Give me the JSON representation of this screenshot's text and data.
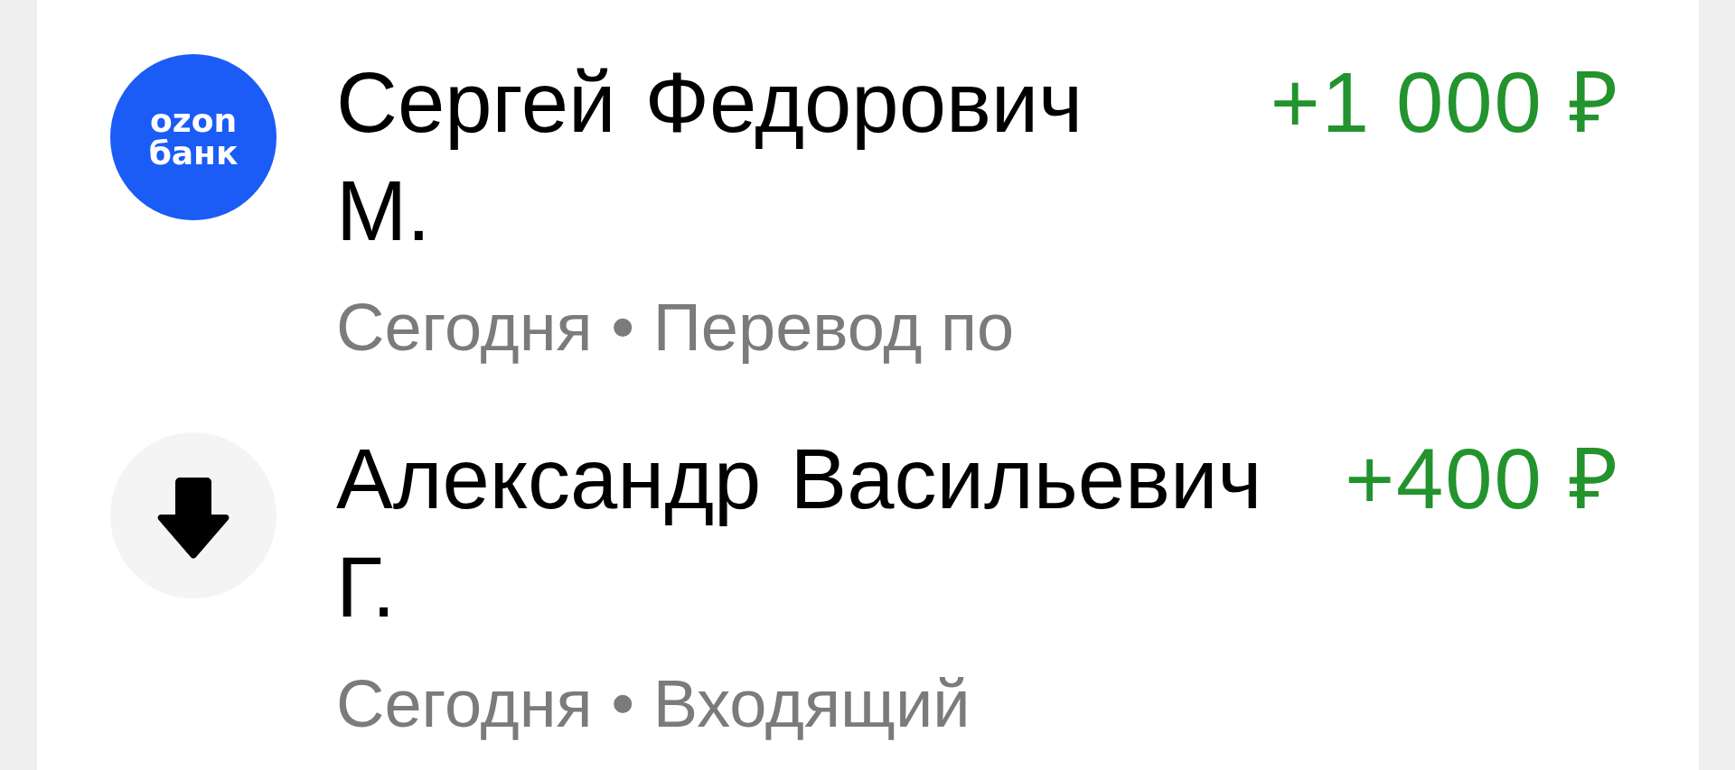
{
  "transactions": [
    {
      "avatar": {
        "kind": "logo",
        "text": [
          "ozon",
          "банк"
        ]
      },
      "name": "Сергей Федорович М.",
      "amount": "+1 000 ₽",
      "details": "Сегодня • Перевод по"
    },
    {
      "avatar": {
        "kind": "incoming"
      },
      "name": "Александр Васильевич Г.",
      "amount": "+400 ₽",
      "details": "Сегодня • Входящий"
    }
  ]
}
